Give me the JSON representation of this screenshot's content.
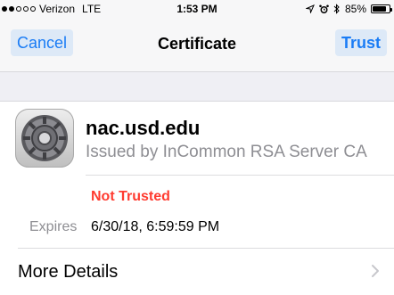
{
  "status_bar": {
    "carrier": "Verizon",
    "network": "LTE",
    "time": "1:53 PM",
    "battery": "85%",
    "battery_level": 0.85,
    "signal_bars_filled": 2,
    "signal_bars_total": 5
  },
  "nav": {
    "cancel_label": "Cancel",
    "title": "Certificate",
    "trust_label": "Trust",
    "accent_color": "#1a7cf5"
  },
  "certificate": {
    "name": "nac.usd.edu",
    "issuer": "Issued by InCommon RSA Server CA",
    "icon": "settings-gear-icon",
    "trust_status": "Not Trusted",
    "trust_status_color": "#ff3b30",
    "expires_label": "Expires",
    "expires_value": "6/30/18, 6:59:59 PM"
  },
  "more_details": {
    "label": "More Details",
    "icon": "chevron-right-icon"
  }
}
